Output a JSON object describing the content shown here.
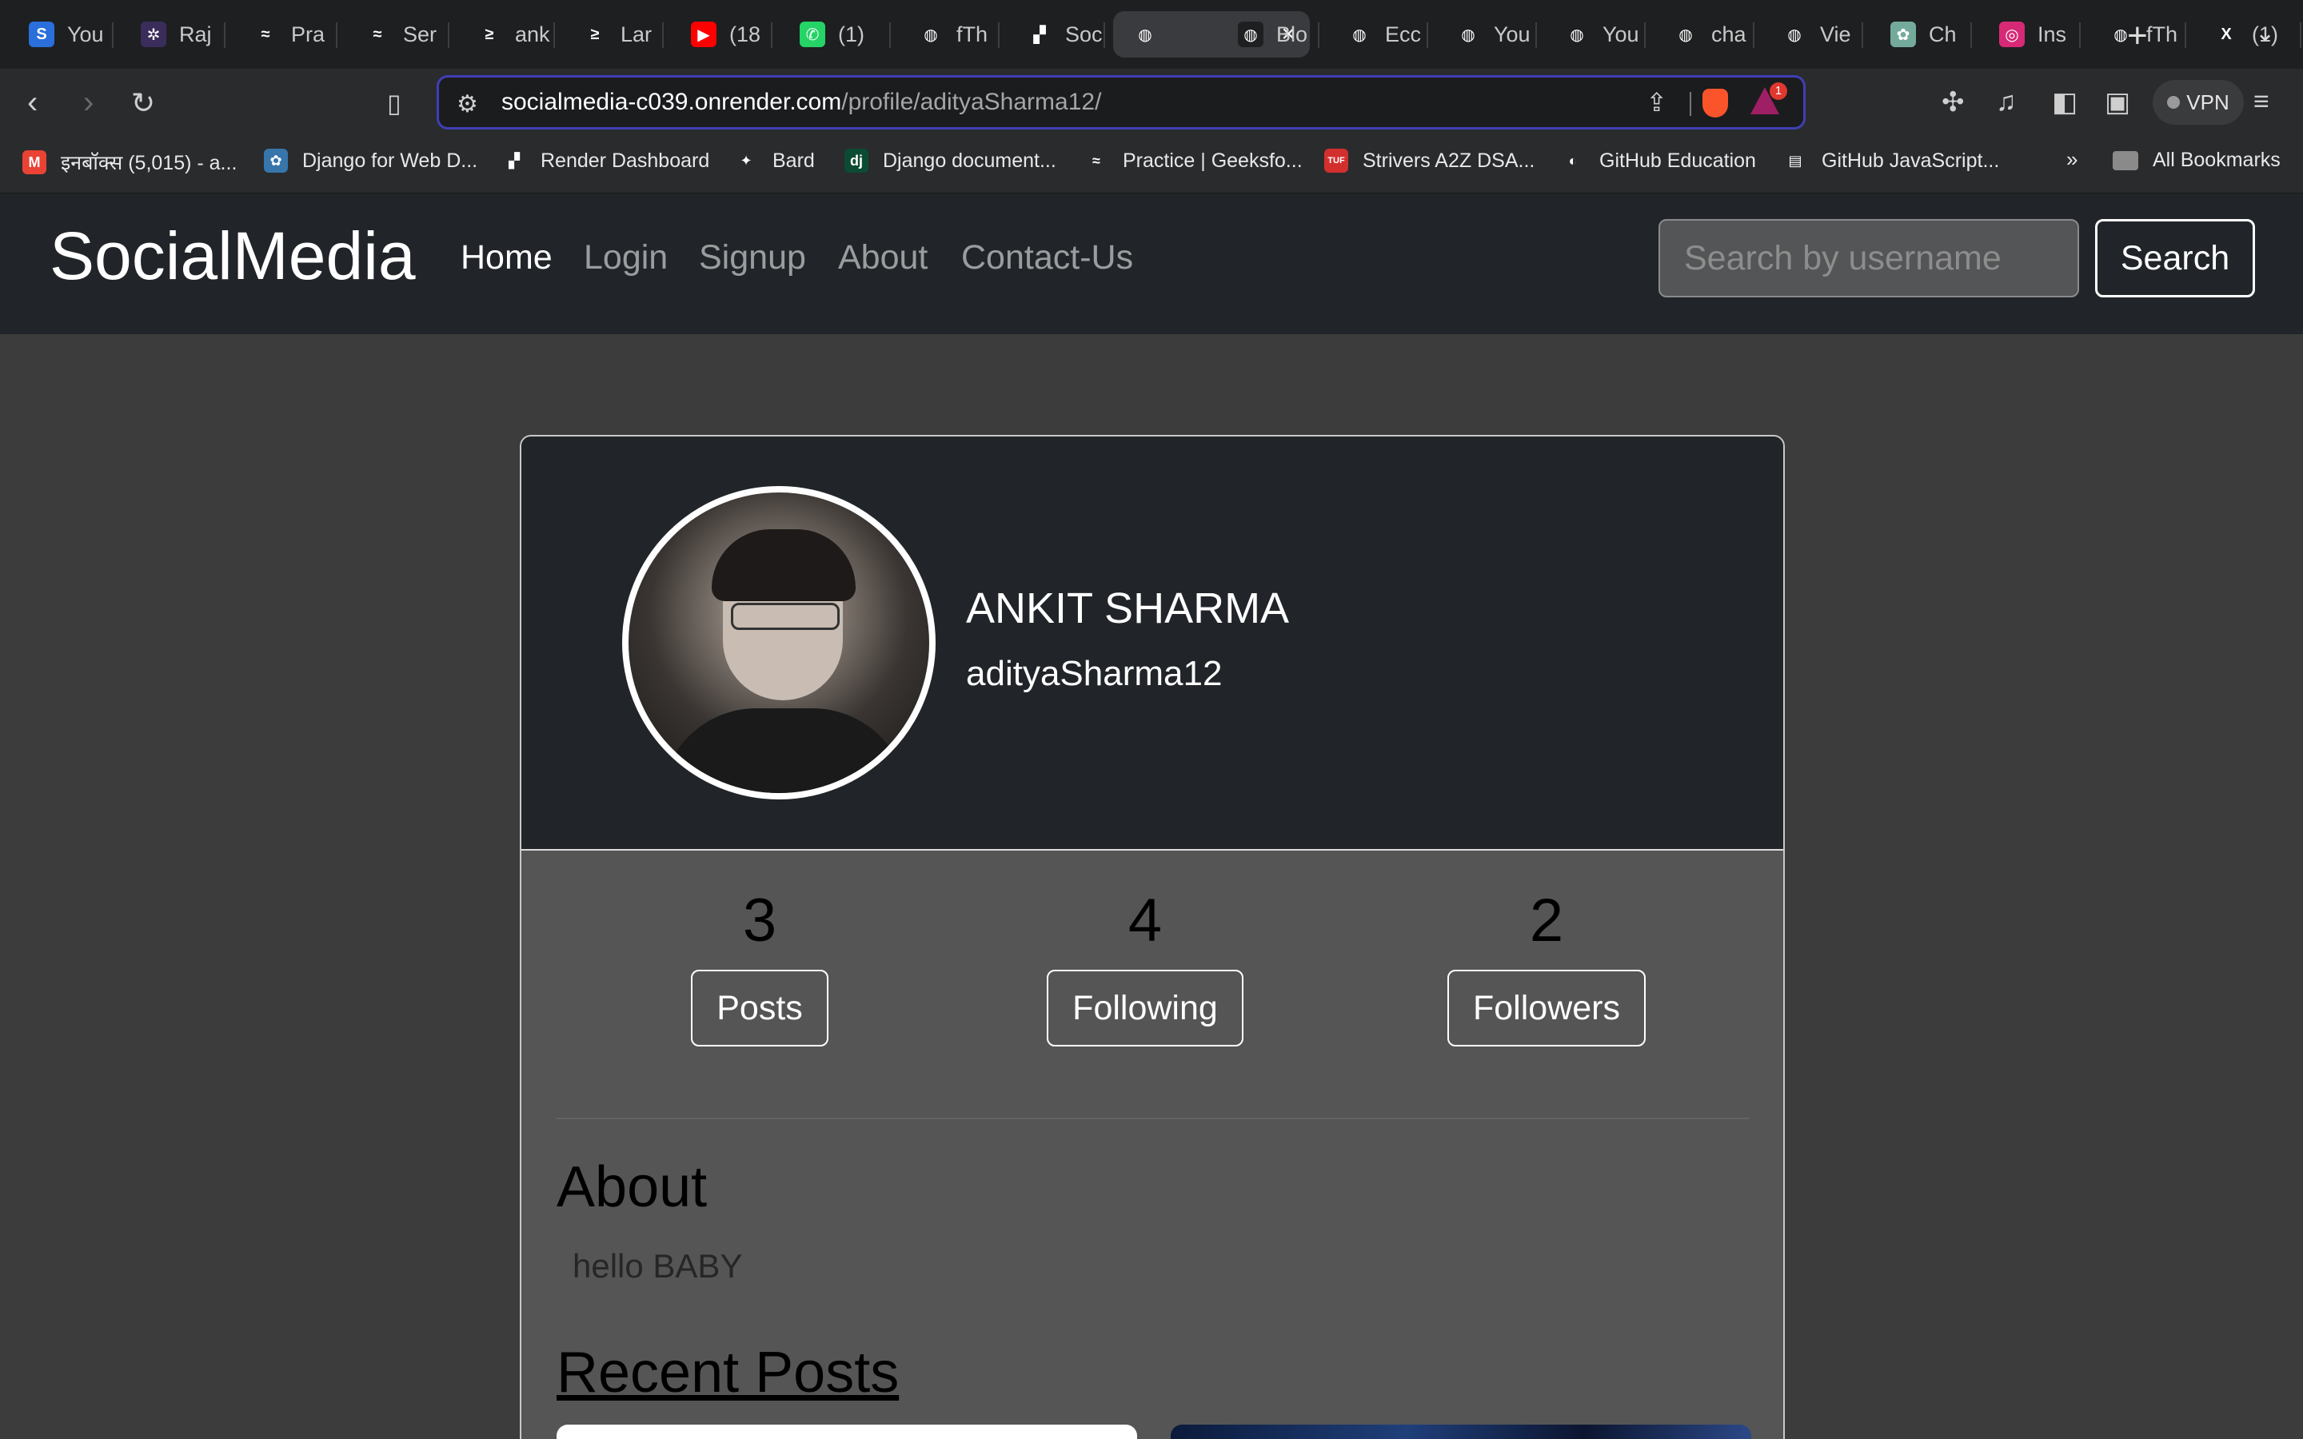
{
  "browser": {
    "tabs": [
      {
        "label": "You",
        "fav": "S",
        "fav_color": "#2a6fdb"
      },
      {
        "label": "Raj",
        "fav": "✲",
        "fav_color": "#3a2d5c"
      },
      {
        "label": "Pra",
        "fav": "≈",
        "fav_color": "#1e1f20"
      },
      {
        "label": "Ser",
        "fav": "≈",
        "fav_color": "#1e1f20"
      },
      {
        "label": "ank",
        "fav": "≥",
        "fav_color": "#1e1f20"
      },
      {
        "label": "Lar",
        "fav": "≥",
        "fav_color": "#1e1f20"
      },
      {
        "label": "(18",
        "fav": "▶",
        "fav_color": "#ff0000"
      },
      {
        "label": "(1)",
        "fav": "✆",
        "fav_color": "#25d366"
      },
      {
        "label": "fTh",
        "fav": "◍",
        "fav_color": "#1e1f20"
      },
      {
        "label": "Soc",
        "fav": "▞",
        "fav_color": "#1e1f20"
      },
      {
        "label": "",
        "fav": "◍",
        "fav_color": "#3a3b3e"
      },
      {
        "label": "Blo",
        "fav": "◍",
        "fav_color": "#1e1f20"
      },
      {
        "label": "Ecc",
        "fav": "◍",
        "fav_color": "#1e1f20"
      },
      {
        "label": "You",
        "fav": "◍",
        "fav_color": "#1e1f20"
      },
      {
        "label": "You",
        "fav": "◍",
        "fav_color": "#1e1f20"
      },
      {
        "label": "cha",
        "fav": "◍",
        "fav_color": "#1e1f20"
      },
      {
        "label": "Vie",
        "fav": "◍",
        "fav_color": "#1e1f20"
      },
      {
        "label": "Ch",
        "fav": "✿",
        "fav_color": "#74aa9c"
      },
      {
        "label": "Ins",
        "fav": "◎",
        "fav_color": "#d62976"
      },
      {
        "label": "fTh",
        "fav": "◍",
        "fav_color": "#1e1f20"
      },
      {
        "label": "(1)",
        "fav": "X",
        "fav_color": "#1e1f20"
      }
    ],
    "active_tab_index": 10,
    "url_host": "socialmedia-c039.onrender.com",
    "url_path": "/profile/adityaSharma12/",
    "vpn_label": "VPN",
    "bat_badge": "1",
    "bookmarks": [
      {
        "label": "इनबॉक्स (5,015) - a...",
        "fav": "M",
        "fav_color": "#ea4335"
      },
      {
        "label": "Django for Web D...",
        "fav": "✿",
        "fav_color": "#3776ab"
      },
      {
        "label": "Render Dashboard",
        "fav": "▞",
        "fav_color": "#2a2b2d"
      },
      {
        "label": "Bard",
        "fav": "✦",
        "fav_color": "#2a2b2d"
      },
      {
        "label": "Django document...",
        "fav": "dj",
        "fav_color": "#0c4b33"
      },
      {
        "label": "Practice | Geeksfo...",
        "fav": "≈",
        "fav_color": "#2a2b2d"
      },
      {
        "label": "Strivers A2Z DSA...",
        "fav": "TUF",
        "fav_color": "#d32f2f"
      },
      {
        "label": "GitHub Education",
        "fav": "◐",
        "fav_color": "#2a2b2d"
      },
      {
        "label": "GitHub JavaScript...",
        "fav": "▤",
        "fav_color": "#2a2b2d"
      }
    ],
    "more_bookmarks": "»",
    "all_bookmarks": "All Bookmarks"
  },
  "site": {
    "brand": "SocialMedia",
    "nav": [
      "Home",
      "Login",
      "Signup",
      "About",
      "Contact-Us"
    ],
    "active_nav": "Home",
    "search_placeholder": "Search by username",
    "search_button": "Search"
  },
  "profile": {
    "full_name": "ANKIT SHARMA",
    "username": "adityaSharma12",
    "stats": [
      {
        "count": "3",
        "label": "Posts"
      },
      {
        "count": "4",
        "label": "Following"
      },
      {
        "count": "2",
        "label": "Followers"
      }
    ],
    "about_heading": "About",
    "about_text": "hello BABY",
    "recent_posts_heading": "Recent Posts"
  },
  "colors": {
    "page_bg": "#3b3c3b",
    "navbar_bg": "#212529",
    "card_body_bg": "#555555",
    "omnibox_border": "#3f3fb5"
  }
}
